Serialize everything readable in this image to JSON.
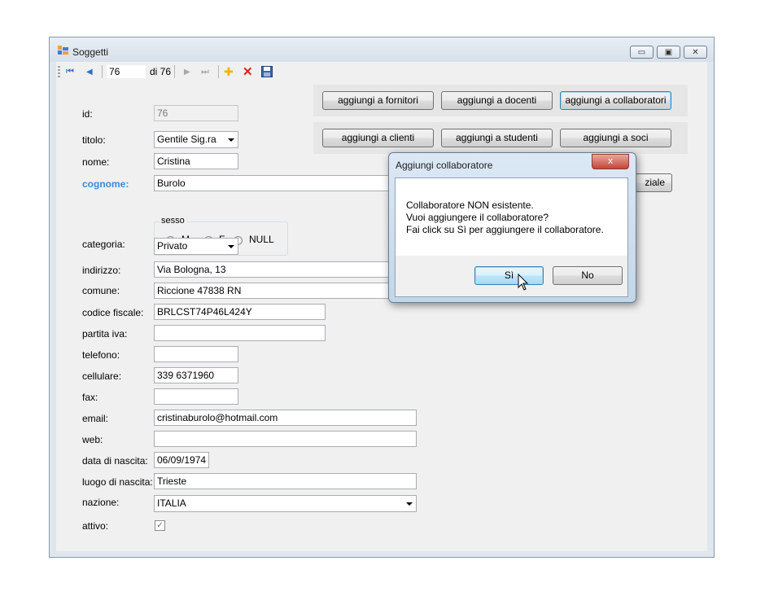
{
  "window": {
    "title": "Soggetti",
    "controls": {
      "minimize": "▭",
      "maximize": "▣",
      "close": "✕"
    }
  },
  "toolbar": {
    "first_icon": "⏮",
    "prev_icon": "◀",
    "position_value": "76",
    "count_label": "di 76",
    "next_icon": "▶",
    "last_icon": "⏭",
    "add_icon": "✚",
    "delete_icon": "✕",
    "save_icon": "save-icon"
  },
  "actions": {
    "row1": [
      "aggiungi a fornitori",
      "aggiungi a docenti",
      "aggiungi a collaboratori"
    ],
    "row2": [
      "aggiungi a clienti",
      "aggiungi a studenti",
      "aggiungi a soci"
    ],
    "partial_button": "ziale"
  },
  "form": {
    "id": {
      "label": "id:",
      "value": "76"
    },
    "titolo": {
      "label": "titolo:",
      "value": "Gentile Sig.ra"
    },
    "nome": {
      "label": "nome:",
      "value": "Cristina"
    },
    "cognome": {
      "label": "cognome:",
      "value": "Burolo"
    },
    "sesso": {
      "label": "sesso",
      "options": [
        "M",
        "F",
        "NULL"
      ],
      "selected": "F"
    },
    "categoria": {
      "label": "categoria:",
      "value": "Privato"
    },
    "indirizzo": {
      "label": "indirizzo:",
      "value": "Via Bologna, 13"
    },
    "comune": {
      "label": "comune:",
      "value": "Riccione 47838 RN"
    },
    "codice_fiscale": {
      "label": "codice fiscale:",
      "value": "BRLCST74P46L424Y"
    },
    "partita_iva": {
      "label": "partita iva:",
      "value": ""
    },
    "telefono": {
      "label": "telefono:",
      "value": ""
    },
    "cellulare": {
      "label": "cellulare:",
      "value": "339 6371960"
    },
    "fax": {
      "label": "fax:",
      "value": ""
    },
    "email": {
      "label": "email:",
      "value": "cristinaburolo@hotmail.com"
    },
    "web": {
      "label": "web:",
      "value": ""
    },
    "data_nascita": {
      "label": "data di nascita:",
      "value": "06/09/1974"
    },
    "luogo_nascita": {
      "label": "luogo di nascita:",
      "value": "Trieste"
    },
    "nazione": {
      "label": "nazione:",
      "value": "ITALIA"
    },
    "attivo": {
      "label": "attivo:",
      "checked": true
    }
  },
  "dialog": {
    "title": "Aggiungi collaboratore",
    "close_glyph": "x",
    "message": [
      "Collaboratore NON esistente.",
      "Vuoi aggiungere il collaboratore?",
      "Fai click su Sì per aggiungere il collaboratore."
    ],
    "yes_label": "Sì",
    "no_label": "No"
  },
  "colors": {
    "accent_label": "#3b8ad8",
    "delete_red": "#e0201b",
    "add_yellow": "#f0b400",
    "nav_blue": "#2f6fc4"
  }
}
